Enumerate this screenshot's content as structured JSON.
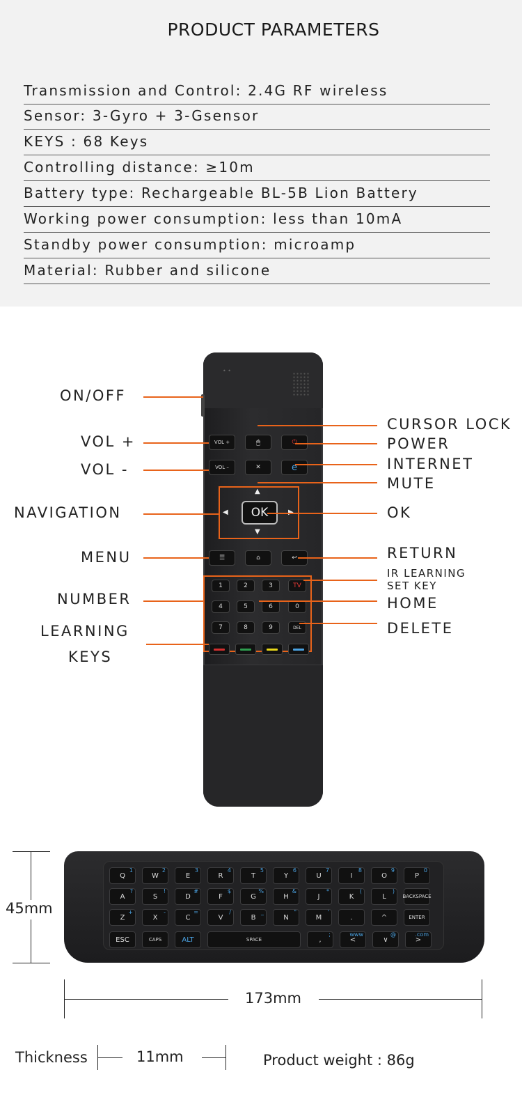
{
  "params": {
    "title": "PRODUCT PARAMETERS",
    "rows": [
      "Transmission and Control: 2.4G RF wireless",
      "Sensor: 3-Gyro + 3-Gsensor",
      "KEYS : 68 Keys",
      "Controlling distance: ≥10m",
      "Battery type: Rechargeable BL-5B Lion Battery",
      "Working power consumption: less than 10mA",
      "Standby power consumption: microamp",
      "Material: Rubber and silicone"
    ]
  },
  "remote": {
    "left_labels": {
      "onoff": "ON/OFF",
      "volup": "VOL +",
      "voldown": "VOL -",
      "navigation": "NAVIGATION",
      "menu": "MENU",
      "number": "NUMBER",
      "learning1": "LEARNING",
      "learning2": "KEYS"
    },
    "right_labels": {
      "cursor_lock": "CURSOR LOCK",
      "power": "POWER",
      "internet": "INTERNET",
      "mute": "MUTE",
      "ok": "OK",
      "return": "RETURN",
      "ir1": "IR LEARNING",
      "ir2": "SET KEY",
      "home": "HOME",
      "delete": "DELETE"
    },
    "keys": {
      "vol_up": "VOL +",
      "vol_down": "VOL –",
      "ok": "OK",
      "tv": "TV",
      "del": "DEL",
      "numbers": [
        "1",
        "2",
        "3",
        "4",
        "5",
        "6",
        "7",
        "8",
        "9",
        "0"
      ]
    },
    "learning_colors": [
      "#d32f2f",
      "#2e9e4f",
      "#e8d81a",
      "#4ba3e3"
    ],
    "accent_color": "#e8631a"
  },
  "keyboard": {
    "row1": [
      [
        "Q",
        "1"
      ],
      [
        "W",
        "2"
      ],
      [
        "E",
        "3"
      ],
      [
        "R",
        "4"
      ],
      [
        "T",
        "5"
      ],
      [
        "Y",
        "6"
      ],
      [
        "U",
        "7"
      ],
      [
        "I",
        "8"
      ],
      [
        "O",
        "9"
      ],
      [
        "P",
        "0"
      ]
    ],
    "row2": [
      [
        "A",
        "?"
      ],
      [
        "S",
        "!"
      ],
      [
        "D",
        "#"
      ],
      [
        "F",
        "$"
      ],
      [
        "G",
        "%"
      ],
      [
        "H",
        "&"
      ],
      [
        "J",
        "*"
      ],
      [
        "K",
        "("
      ],
      [
        "L",
        ")"
      ],
      [
        "BACKSPACE",
        ""
      ]
    ],
    "row3": [
      [
        "Z",
        "+"
      ],
      [
        "X",
        "-"
      ],
      [
        "C",
        "="
      ],
      [
        "V",
        "/"
      ],
      [
        "B",
        "_"
      ],
      [
        "N",
        "\""
      ],
      [
        "M",
        "'"
      ],
      [
        ".",
        ""
      ],
      [
        "^",
        ""
      ],
      [
        "ENTER",
        ""
      ]
    ],
    "row4": [
      [
        "ESC",
        ""
      ],
      [
        "CAPS",
        ""
      ],
      [
        "ALT",
        ""
      ],
      [
        "SPACE",
        ""
      ],
      [
        ",",
        ";"
      ],
      [
        "<",
        "www"
      ],
      [
        "∨",
        "@"
      ],
      [
        ">",
        ".com"
      ]
    ]
  },
  "dimensions": {
    "height": "45mm",
    "width": "173mm",
    "thickness_label": "Thickness",
    "thickness": "11mm",
    "weight": "Product weight : 86g"
  }
}
